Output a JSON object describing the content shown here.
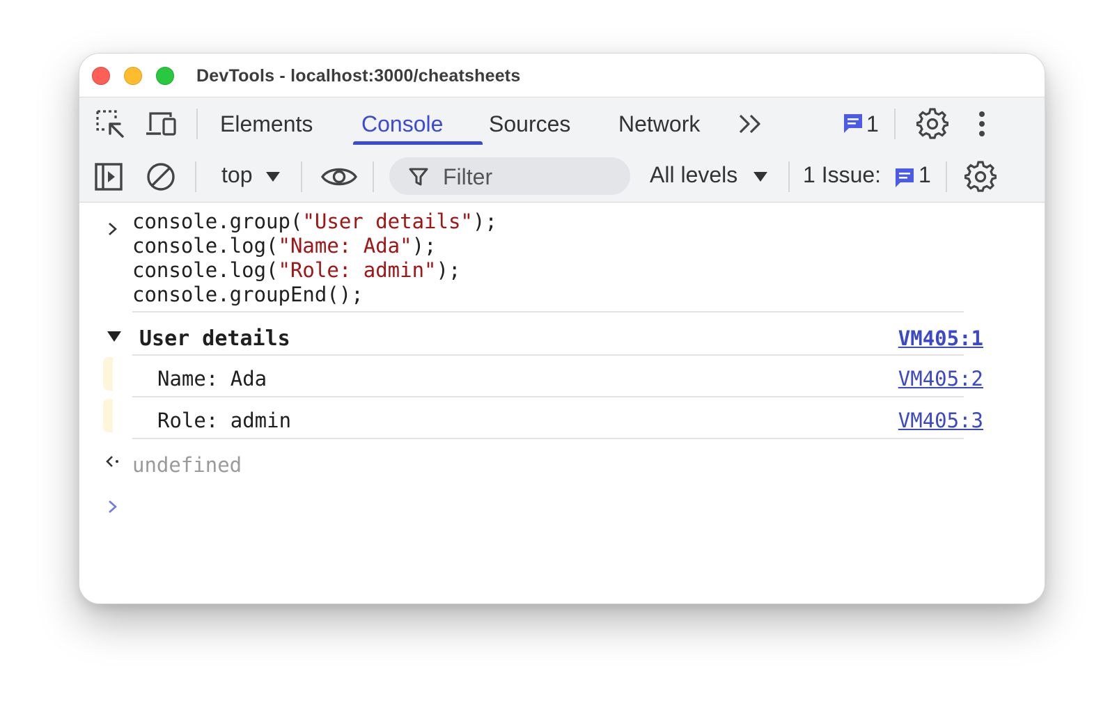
{
  "window": {
    "title": "DevTools - localhost:3000/cheatsheets"
  },
  "tabs": [
    {
      "label": "Elements",
      "active": false
    },
    {
      "label": "Console",
      "active": true
    },
    {
      "label": "Sources",
      "active": false
    },
    {
      "label": "Network",
      "active": false
    }
  ],
  "tabbar": {
    "messages_count": "1"
  },
  "toolbar": {
    "context": "top",
    "filter_placeholder": "Filter",
    "levels": "All levels",
    "issues_label": "1 Issue:",
    "issues_count": "1"
  },
  "console": {
    "input_lines": [
      {
        "pre": "console.group(",
        "str": "\"User details\"",
        "post": ");"
      },
      {
        "pre": "console.log(",
        "str": "\"Name: Ada\"",
        "post": ");"
      },
      {
        "pre": "console.log(",
        "str": "\"Role: admin\"",
        "post": ");"
      },
      {
        "pre": "console.groupEnd();",
        "str": "",
        "post": ""
      }
    ],
    "group": {
      "title": "User details",
      "source": "VM405:1"
    },
    "logs": [
      {
        "text": "Name: Ada",
        "source": "VM405:2"
      },
      {
        "text": "Role: admin",
        "source": "VM405:3"
      }
    ],
    "result": "undefined"
  },
  "colors": {
    "accent": "#3a4ad6",
    "string": "#a31515",
    "link": "#3b48c8",
    "log_gutter": "#fdf6db",
    "badge": "#4b5ae8"
  }
}
